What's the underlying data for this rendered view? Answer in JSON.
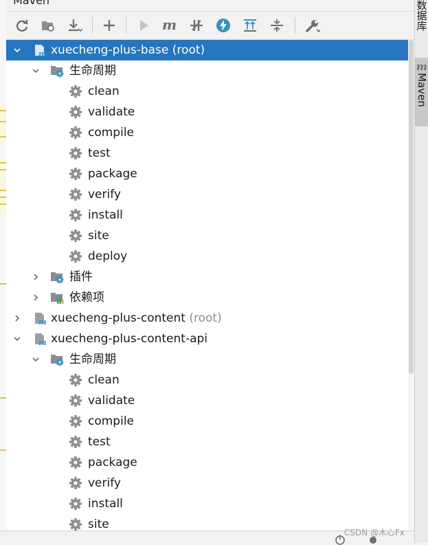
{
  "panel": {
    "title": "Maven"
  },
  "toolbar": {
    "buttons": [
      {
        "name": "reload-icon"
      },
      {
        "name": "generate-sources-icon"
      },
      {
        "name": "download-icon"
      },
      {
        "name": "add-icon"
      },
      {
        "name": "run-icon"
      },
      {
        "name": "execute-goal-icon"
      },
      {
        "name": "toggle-offline-icon"
      },
      {
        "name": "skip-tests-icon"
      },
      {
        "name": "show-dependencies-icon"
      },
      {
        "name": "collapse-all-icon"
      },
      {
        "name": "settings-wrench-icon"
      }
    ]
  },
  "tree": {
    "rows": [
      {
        "level": 0,
        "chevron": "down",
        "icon": "maven-module-icon",
        "label": "xuecheng-plus-base",
        "suffix": " (root)",
        "selected": true
      },
      {
        "level": 1,
        "chevron": "down",
        "icon": "lifecycle-folder-icon",
        "label": "生命周期"
      },
      {
        "level": 2,
        "icon": "gear-icon",
        "label": "clean"
      },
      {
        "level": 2,
        "icon": "gear-icon",
        "label": "validate"
      },
      {
        "level": 2,
        "icon": "gear-icon",
        "label": "compile"
      },
      {
        "level": 2,
        "icon": "gear-icon",
        "label": "test"
      },
      {
        "level": 2,
        "icon": "gear-icon",
        "label": "package"
      },
      {
        "level": 2,
        "icon": "gear-icon",
        "label": "verify"
      },
      {
        "level": 2,
        "icon": "gear-icon",
        "label": "install"
      },
      {
        "level": 2,
        "icon": "gear-icon",
        "label": "site"
      },
      {
        "level": 2,
        "icon": "gear-icon",
        "label": "deploy"
      },
      {
        "level": 1,
        "chevron": "right",
        "icon": "plugins-folder-icon",
        "label": "插件"
      },
      {
        "level": 1,
        "chevron": "right",
        "icon": "dependencies-folder-icon",
        "label": "依赖项"
      },
      {
        "level": 0,
        "chevron": "right",
        "icon": "maven-module-icon",
        "label": "xuecheng-plus-content",
        "suffix": " (root)"
      },
      {
        "level": 0,
        "chevron": "down",
        "icon": "maven-module-icon",
        "label": "xuecheng-plus-content-api"
      },
      {
        "level": 1,
        "chevron": "down",
        "icon": "lifecycle-folder-icon",
        "label": "生命周期"
      },
      {
        "level": 2,
        "icon": "gear-icon",
        "label": "clean"
      },
      {
        "level": 2,
        "icon": "gear-icon",
        "label": "validate"
      },
      {
        "level": 2,
        "icon": "gear-icon",
        "label": "compile"
      },
      {
        "level": 2,
        "icon": "gear-icon",
        "label": "test"
      },
      {
        "level": 2,
        "icon": "gear-icon",
        "label": "package"
      },
      {
        "level": 2,
        "icon": "gear-icon",
        "label": "verify"
      },
      {
        "level": 2,
        "icon": "gear-icon",
        "label": "install"
      },
      {
        "level": 2,
        "icon": "gear-icon",
        "label": "site"
      }
    ]
  },
  "side_tabs": {
    "database": "数据库",
    "maven": "Maven"
  },
  "watermark": "CSDN @木心Fx",
  "colors": {
    "selection": "#2675bf",
    "icon_blue": "#3592c4",
    "icon_gray": "#8a8f94"
  }
}
